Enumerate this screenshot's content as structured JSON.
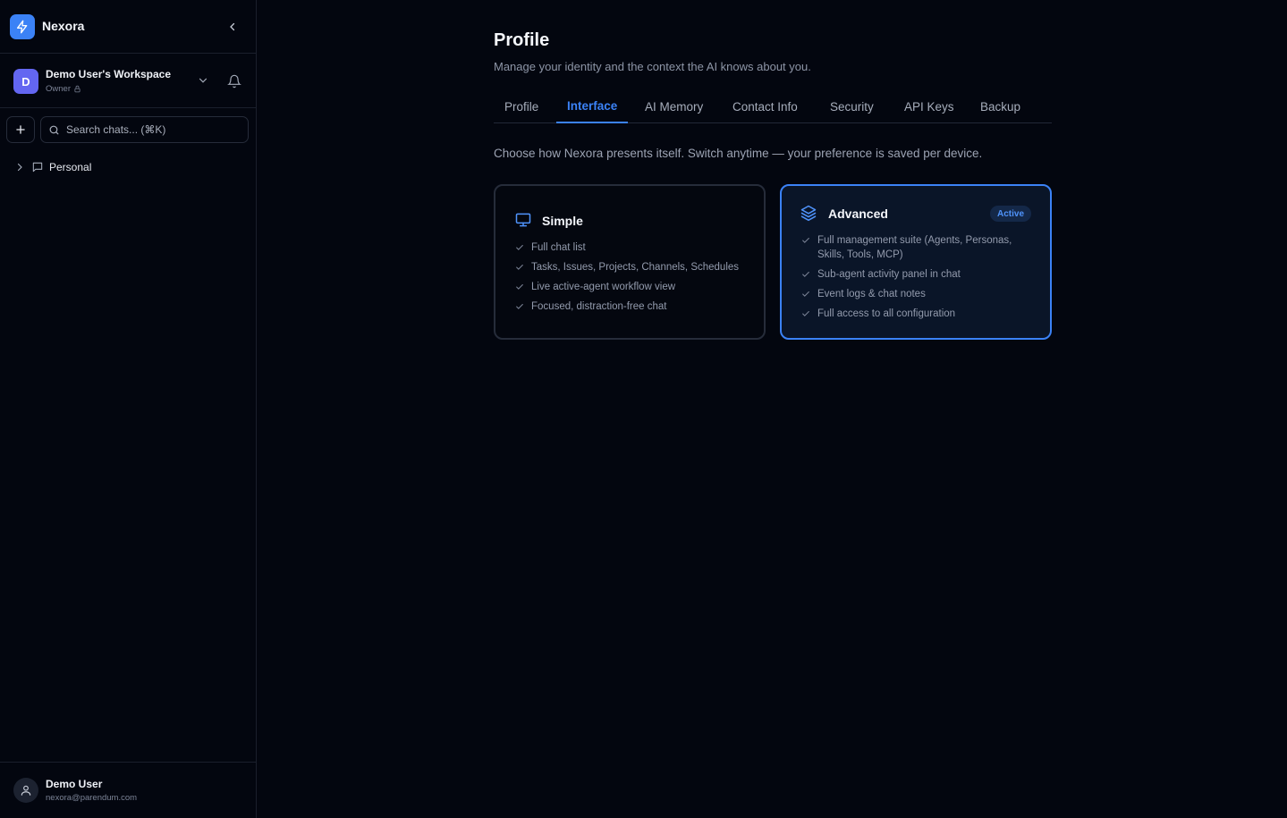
{
  "sidebar": {
    "brand_name": "Nexora",
    "workspace": {
      "avatar_letter": "D",
      "name": "Demo User's Workspace",
      "role": "Owner"
    },
    "search": {
      "placeholder": "Search chats... (⌘K)"
    },
    "tree": [
      {
        "label": "Personal"
      }
    ],
    "user": {
      "name": "Demo User",
      "email": "nexora@parendum.com"
    }
  },
  "main": {
    "title": "Profile",
    "subtitle": "Manage your identity and the context the AI knows about you.",
    "tabs": [
      {
        "label": "Profile",
        "active": false
      },
      {
        "label": "Interface",
        "active": true
      },
      {
        "label": "AI Memory",
        "active": false
      },
      {
        "label": "Contact Info",
        "active": false
      },
      {
        "label": "Security",
        "active": false
      },
      {
        "label": "API Keys",
        "active": false
      },
      {
        "label": "Backup",
        "active": false
      }
    ],
    "intro": "Choose how Nexora presents itself. Switch anytime — your preference is saved per device.",
    "modes": [
      {
        "icon": "monitor-icon",
        "title": "Simple",
        "features": [
          "Full chat list",
          "Tasks, Issues, Projects, Channels, Schedules",
          "Live active-agent workflow view",
          "Focused, distraction-free chat"
        ]
      },
      {
        "icon": "layers-icon",
        "title": "Advanced",
        "badge": "Active",
        "features": [
          "Full management suite (Agents, Personas, Skills, Tools, MCP)",
          "Sub-agent activity panel in chat",
          "Event logs & chat notes",
          "Full access to all configuration"
        ]
      }
    ]
  },
  "colors": {
    "background": "#03060f",
    "accent": "#3b82f6",
    "workspace_avatar": "#6366f1"
  }
}
